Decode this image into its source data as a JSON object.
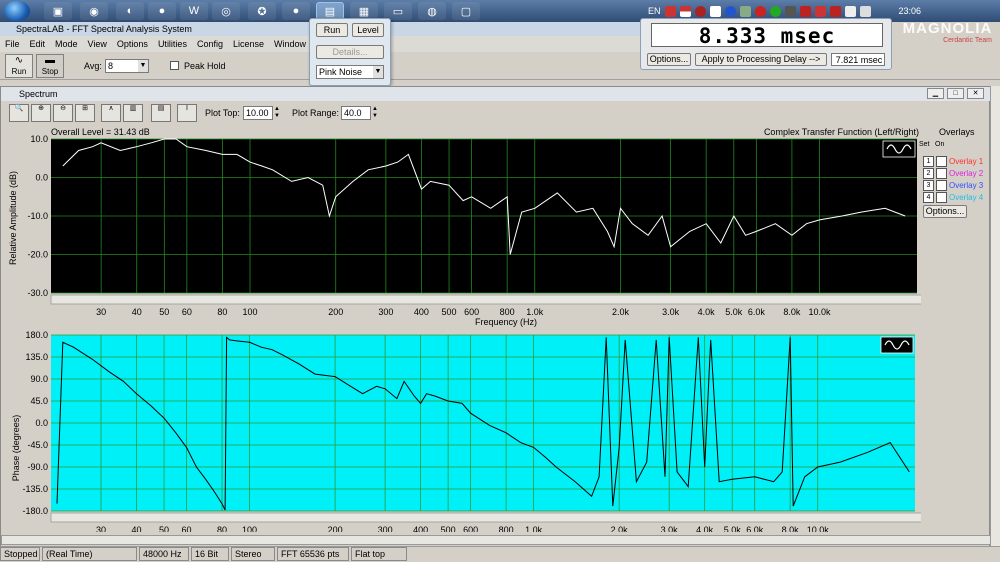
{
  "taskbar": {
    "language": "EN",
    "clock": "23:06"
  },
  "app": {
    "title": "SpectraLAB - FFT Spectral Analysis System",
    "menu": [
      "File",
      "Edit",
      "Mode",
      "View",
      "Options",
      "Utilities",
      "Config",
      "License",
      "Window"
    ]
  },
  "toolbar": {
    "run_label": "Run",
    "stop_label": "Stop",
    "avg_label": "Avg:",
    "avg_value": "8",
    "peak_hold_label": "Peak Hold"
  },
  "generator_popup": {
    "run_label": "Run",
    "level_label": "Level",
    "details_label": "Details...",
    "signal_value": "Pink Noise"
  },
  "delay_panel": {
    "display": "8.333 msec",
    "options_label": "Options...",
    "apply_label": "Apply to Processing Delay -->",
    "applied_value": "7.821 msec"
  },
  "brand": {
    "name": "MAGNOLIA",
    "sub": "Cerdantic Team"
  },
  "spectrum_window": {
    "title": "Spectrum",
    "plot_top_label": "Plot Top:",
    "plot_top_value": "10.00",
    "plot_range_label": "Plot Range:",
    "plot_range_value": "40.0",
    "overall_level": "Overall Level = 31.43 dB",
    "mode_label": "Complex Transfer Function (Left/Right)",
    "overlays_title": "Overlays",
    "set_label": "Set",
    "on_label": "On",
    "overlays": [
      {
        "num": "1",
        "label": "Overlay 1",
        "color": "#ff3030"
      },
      {
        "num": "2",
        "label": "Overlay 2",
        "color": "#e020e0"
      },
      {
        "num": "3",
        "label": "Overlay 3",
        "color": "#3050ff"
      },
      {
        "num": "4",
        "label": "Overlay 4",
        "color": "#20c0e0"
      }
    ],
    "overlay_options_label": "Options..."
  },
  "chart_data": [
    {
      "type": "line",
      "ylabel": "Relative Amplitude (dB)",
      "xlabel": "Frequency (Hz)",
      "x_scale": "log",
      "xlim": [
        20,
        22000
      ],
      "ylim": [
        -30,
        10
      ],
      "yticks": [
        10.0,
        0.0,
        -10.0,
        -20.0,
        -30.0
      ],
      "ytick_labels": [
        "10.0",
        "0.0",
        "-10.0",
        "-20.0",
        "-30.0"
      ],
      "xticks": [
        30,
        40,
        50,
        60,
        80,
        100,
        200,
        300,
        400,
        500,
        600,
        800,
        1000,
        2000,
        3000,
        4000,
        5000,
        6000,
        8000,
        10000
      ],
      "xtick_labels": [
        "30",
        "40",
        "50",
        "60",
        "80",
        "100",
        "200",
        "300",
        "400",
        "500",
        "600",
        "800",
        "1.0k",
        "2.0k",
        "3.0k",
        "4.0k",
        "5.0k",
        "6.0k",
        "8.0k",
        "10.0k"
      ],
      "background": "#000000",
      "line_color": "#ffffff",
      "grid": true,
      "series": [
        {
          "x": [
            22,
            25,
            28,
            30,
            35,
            40,
            45,
            50,
            55,
            60,
            70,
            80,
            90,
            100,
            110,
            120,
            140,
            160,
            180,
            190,
            200,
            230,
            260,
            300,
            330,
            360,
            400,
            430,
            500,
            560,
            600,
            700,
            800,
            820,
            900,
            1000,
            1200,
            1400,
            1600,
            1800,
            1900,
            2000,
            2200,
            2500,
            2800,
            3000,
            3500,
            4000,
            4500,
            5000,
            5500,
            6000,
            7000,
            8000,
            9000,
            10000,
            12000,
            14000,
            17000,
            20000
          ],
          "y": [
            3,
            7,
            8,
            9,
            7,
            8,
            9,
            10,
            10,
            8,
            7,
            6,
            6,
            4,
            3,
            2,
            -1,
            0,
            -2,
            -10,
            -5,
            -1,
            2,
            3,
            4,
            6,
            -3,
            -1,
            -2,
            -6,
            -5,
            -8,
            -5,
            -20,
            -9,
            -8,
            -4,
            -9,
            -8,
            -14,
            -18,
            -8,
            -12,
            -15,
            -10,
            -18,
            -14,
            -12,
            -17,
            -10,
            -15,
            -14,
            -12,
            -15,
            -12,
            -11,
            -10,
            -9,
            -8,
            -10
          ]
        }
      ]
    },
    {
      "type": "line",
      "ylabel": "Phase (degrees)",
      "xlabel": "",
      "x_scale": "log",
      "xlim": [
        20,
        22000
      ],
      "ylim": [
        -180,
        180
      ],
      "yticks": [
        180.0,
        135.0,
        90.0,
        45.0,
        0.0,
        -45.0,
        -90.0,
        -135.0,
        -180.0
      ],
      "ytick_labels": [
        "180.0",
        "135.0",
        "90.0",
        "45.0",
        "0.0",
        "-45.0",
        "-90.0",
        "-135.0",
        "-180.0"
      ],
      "xticks": [
        30,
        40,
        50,
        60,
        80,
        100,
        200,
        300,
        400,
        500,
        600,
        800,
        1000,
        2000,
        3000,
        4000,
        5000,
        6000,
        8000,
        10000
      ],
      "xtick_labels": [
        "30",
        "40",
        "50",
        "60",
        "80",
        "100",
        "200",
        "300",
        "400",
        "500",
        "600",
        "800",
        "1.0k",
        "2.0k",
        "3.0k",
        "4.0k",
        "5.0k",
        "6.0k",
        "8.0k",
        "10.0k"
      ],
      "background": "#00f0f8",
      "line_color": "#000000",
      "grid": true,
      "series": [
        {
          "x": [
            21,
            22,
            24,
            28,
            32,
            36,
            40,
            45,
            50,
            55,
            60,
            65,
            70,
            75,
            80,
            82,
            83,
            85,
            90,
            100,
            110,
            120,
            130,
            150,
            170,
            200,
            220,
            250,
            280,
            300,
            330,
            350,
            380,
            400,
            420,
            450,
            500,
            560,
            600,
            700,
            800,
            900,
            1000,
            1100,
            1200,
            1400,
            1600,
            1700,
            1800,
            1900,
            2000,
            2100,
            2300,
            2500,
            2700,
            2900,
            3000,
            3200,
            3500,
            3800,
            4000,
            4200,
            4500,
            5000,
            6000,
            7000,
            7500,
            8000,
            8200,
            9000,
            10000,
            12000,
            15000,
            18000,
            21000
          ],
          "y": [
            -165,
            165,
            155,
            130,
            105,
            85,
            60,
            35,
            10,
            -20,
            -50,
            -90,
            -115,
            -140,
            -165,
            -178,
            175,
            170,
            168,
            165,
            155,
            150,
            140,
            120,
            100,
            95,
            80,
            60,
            75,
            70,
            50,
            85,
            55,
            40,
            60,
            55,
            45,
            40,
            20,
            -5,
            -20,
            -40,
            -50,
            -70,
            -90,
            -120,
            -150,
            -110,
            175,
            -170,
            -50,
            170,
            -120,
            -80,
            170,
            -110,
            175,
            -100,
            -130,
            175,
            -90,
            170,
            -120,
            -115,
            -110,
            -120,
            -100,
            175,
            -170,
            -110,
            -90,
            -80,
            -60,
            -40,
            -100
          ]
        }
      ]
    }
  ],
  "status": {
    "state": "Stopped",
    "mode": "(Real Time)",
    "rate": "48000 Hz",
    "bits": "16 Bit",
    "channels": "Stereo",
    "fft": "FFT 65536 pts",
    "window": "Flat top"
  }
}
